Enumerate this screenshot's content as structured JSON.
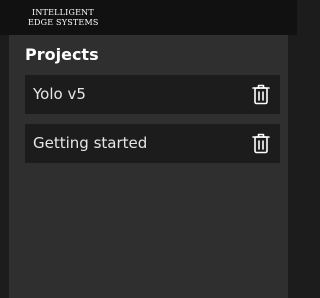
{
  "header": {
    "logo_line1": "INTELLIGENT",
    "logo_line2": "EDGE SYSTEMS"
  },
  "panel": {
    "title": "Projects",
    "projects": [
      {
        "name": "Yolo v5",
        "action_icon": "trash-icon"
      },
      {
        "name": "Getting started",
        "action_icon": "trash-icon"
      }
    ]
  },
  "colors": {
    "page_background": "#1c1c1c",
    "topbar": "#111111",
    "panel": "#2f2f2f",
    "item_background": "#1c1c1c",
    "text": "#ffffff"
  }
}
